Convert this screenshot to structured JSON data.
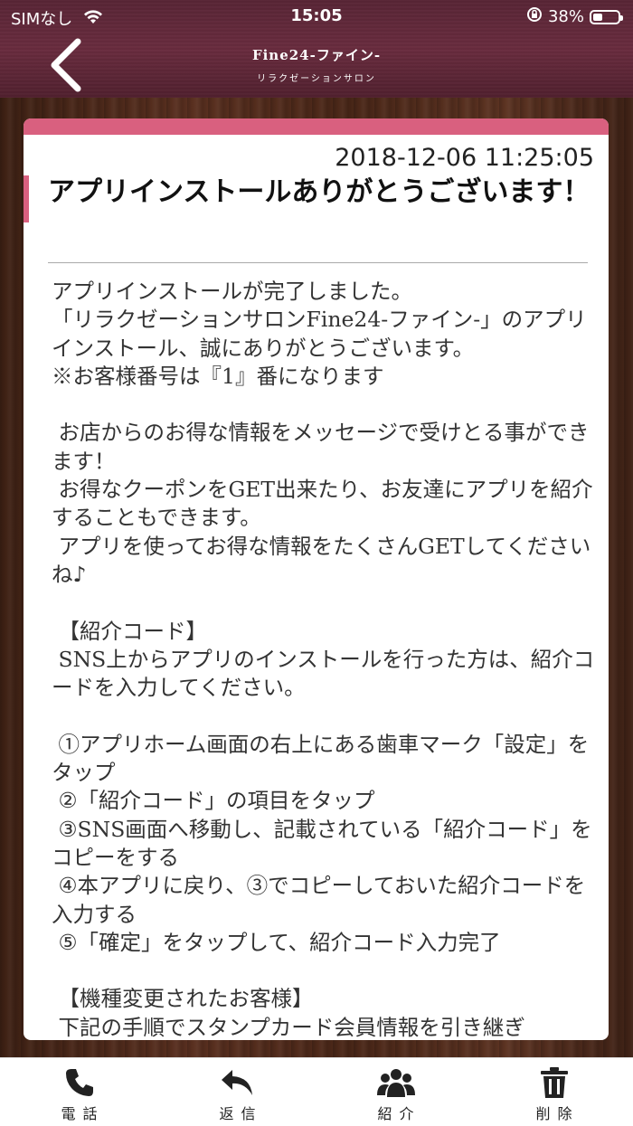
{
  "status_bar": {
    "carrier": "SIMなし",
    "time": "15:05",
    "battery_percent": "38%",
    "battery_level": 0.38
  },
  "header": {
    "title": "Fine24-ファイン-",
    "subtitle": "リラクゼーションサロン"
  },
  "message": {
    "timestamp": "2018-12-06 11:25:05",
    "title": "アプリインストールありがとうございます！",
    "body": "アプリインストールが完了しました。\n「リラクゼーションサロンFine24-ファイン-」のアプリインストール、誠にありがとうございます。\n※お客様番号は『1』番になります\n\n お店からのお得な情報をメッセージで受けとる事ができます！\n お得なクーポンをGET出来たり、お友達にアプリを紹介することもできます。\n アプリを使ってお得な情報をたくさんGETしてくださいね♪\n\n 【紹介コード】\n SNS上からアプリのインストールを行った方は、紹介コードを入力してください。\n\n ①アプリホーム画面の右上にある歯車マーク「設定」をタップ\n ②「紹介コード」の項目をタップ\n ③SNS画面へ移動し、記載されている「紹介コード」をコピーをする\n ④本アプリに戻り、③でコピーしておいた紹介コードを入力する\n ⑤「確定」をタップして、紹介コード入力完了\n\n 【機種変更されたお客様】\n 下記の手順でスタンプカード会員情報を引き継ぎ"
  },
  "tabs": [
    {
      "label": "電話",
      "icon": "phone-icon"
    },
    {
      "label": "返信",
      "icon": "reply-icon"
    },
    {
      "label": "紹介",
      "icon": "users-icon"
    },
    {
      "label": "削除",
      "icon": "trash-icon"
    }
  ],
  "colors": {
    "accent": "#d9607f",
    "header": "#5e2838"
  }
}
